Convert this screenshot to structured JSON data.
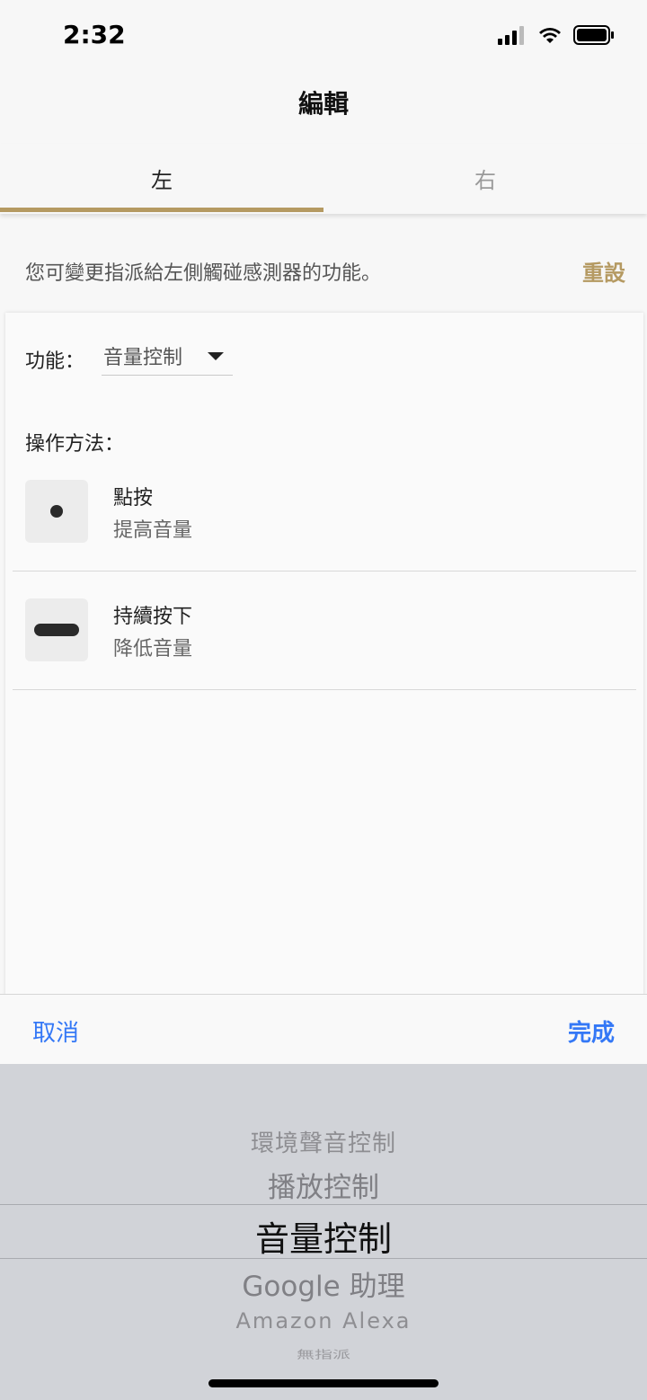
{
  "status_bar": {
    "time": "2:32"
  },
  "nav": {
    "title": "編輯"
  },
  "tabs": [
    {
      "label": "左",
      "selected": true
    },
    {
      "label": "右",
      "selected": false
    }
  ],
  "colors": {
    "accent": "#b59a62",
    "link": "#3478f6"
  },
  "hint": {
    "text": "您可變更指派給左側觸碰感測器的功能。",
    "reset_label": "重設"
  },
  "function": {
    "label": "功能：",
    "selected": "音量控制"
  },
  "operation": {
    "label": "操作方法：",
    "items": [
      {
        "icon": "dot-icon",
        "title": "點按",
        "subtitle": "提高音量"
      },
      {
        "icon": "long-press-bar-icon",
        "title": "持續按下",
        "subtitle": "降低音量"
      }
    ]
  },
  "picker_toolbar": {
    "cancel_label": "取消",
    "done_label": "完成"
  },
  "picker": {
    "options": [
      "環境聲音控制",
      "播放控制",
      "音量控制",
      "Google 助理",
      "Amazon Alexa",
      "無指派"
    ],
    "selected": "音量控制"
  }
}
